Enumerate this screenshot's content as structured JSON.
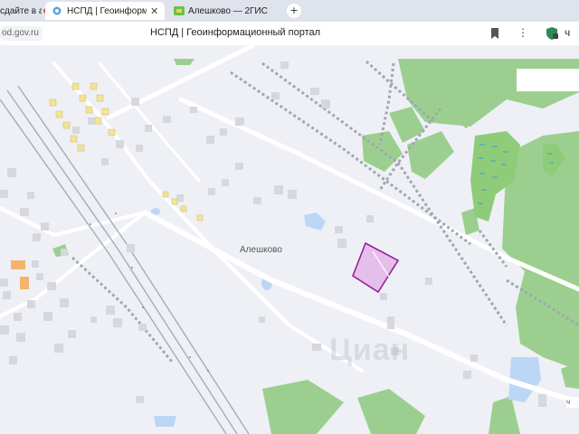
{
  "browser": {
    "tabs": [
      {
        "label": "сдайте в аренду",
        "icon": "ad-favicon-icon"
      },
      {
        "label": "НСПД | Геоинформационный портал",
        "icon": "nspd-favicon-icon"
      },
      {
        "label": "Алешково — 2ГИС",
        "icon": "2gis-favicon-icon"
      }
    ],
    "new_tab_symbol": "+",
    "close_symbol": "✕",
    "url": "od.gov.ru",
    "page_title": "НСПД | Геоинформационный портал",
    "menu_symbol": "⋮",
    "profile_symbol": "ч"
  },
  "map": {
    "place_label": "Алешково",
    "watermark": "Циан",
    "corner_badge": "ч",
    "colors": {
      "background": "#eef0f6",
      "forest": "#9ccf8f",
      "water": "#bcd7f5",
      "building": "#d6d8de",
      "road": "#ffffff",
      "parcel_fill": "#e3b5e8",
      "parcel_border": "#9a1fa0"
    }
  }
}
